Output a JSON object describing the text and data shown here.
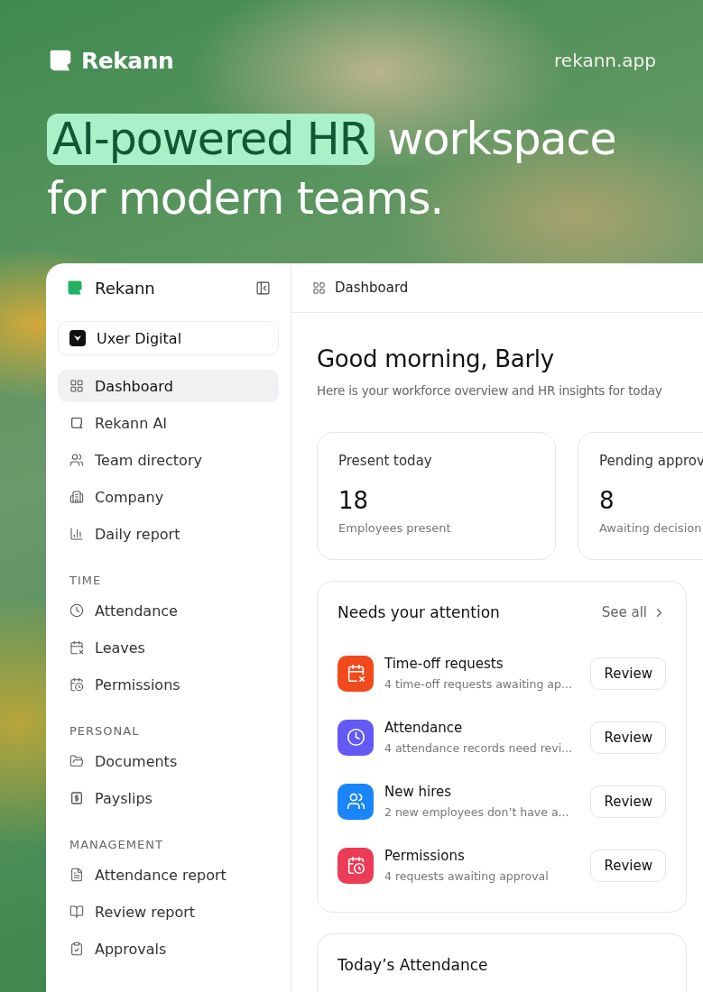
{
  "header": {
    "brand": "Rekann",
    "url": "rekann.app"
  },
  "headline": {
    "highlight": "AI-powered HR",
    "rest": "workspace",
    "line2": "for modern teams."
  },
  "sidebar": {
    "brand": "Rekann",
    "workspace": "Uxer Digital",
    "items": [
      {
        "label": "Dashboard",
        "selected": true
      },
      {
        "label": "Rekann AI",
        "selected": false
      },
      {
        "label": "Team directory",
        "selected": false
      },
      {
        "label": "Company",
        "selected": false
      },
      {
        "label": "Daily report",
        "selected": false
      }
    ],
    "sections": [
      {
        "heading": "TIME",
        "items": [
          {
            "label": "Attendance",
            "selected": false
          },
          {
            "label": "Leaves",
            "selected": false
          },
          {
            "label": "Permissions",
            "selected": false
          }
        ]
      },
      {
        "heading": "PERSONAL",
        "items": [
          {
            "label": "Documents",
            "selected": false
          },
          {
            "label": "Payslips",
            "selected": false
          }
        ]
      },
      {
        "heading": "MANAGEMENT",
        "items": [
          {
            "label": "Attendance report",
            "selected": false
          },
          {
            "label": "Review report",
            "selected": false
          },
          {
            "label": "Approvals",
            "selected": false
          }
        ]
      }
    ]
  },
  "breadcrumb": "Dashboard",
  "greeting": "Good morning, Barly",
  "subtitle": "Here is your workforce overview and HR insights for today",
  "stats": [
    {
      "label": "Present today",
      "value": "18",
      "caption": "Employees present"
    },
    {
      "label": "Pending approv",
      "value": "8",
      "caption": "Awaiting decision"
    }
  ],
  "attention": {
    "title": "Needs your attention",
    "link": "See all",
    "items": [
      {
        "title": "Time-off requests",
        "detail": "4 time-off requests awaiting ap...",
        "color": "#f04a1c",
        "action": "Review"
      },
      {
        "title": "Attendance",
        "detail": "4 attendance records need revi...",
        "color": "#6359f6",
        "action": "Review"
      },
      {
        "title": "New hires",
        "detail": "2 new employees don’t have a...",
        "color": "#1a85f8",
        "action": "Review"
      },
      {
        "title": "Permissions",
        "detail": "4 requests awaiting approval",
        "color": "#ec3b56",
        "action": "Review"
      }
    ]
  },
  "attendance_card": {
    "title": "Today’s Attendance"
  }
}
